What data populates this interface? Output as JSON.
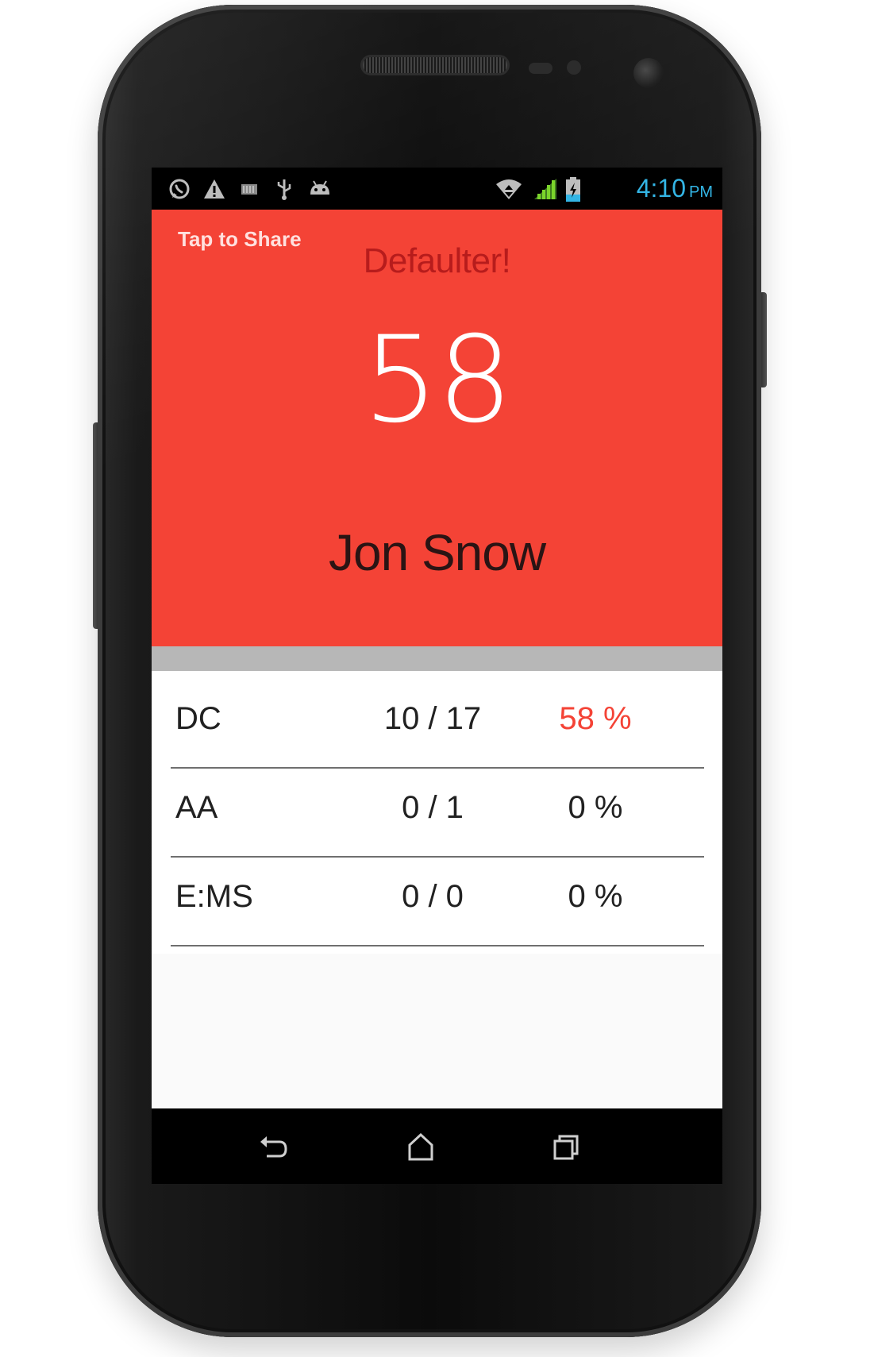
{
  "status_bar": {
    "time": "4:10",
    "ampm": "PM",
    "left_icons": [
      "whatsapp-icon",
      "warning-icon",
      "sdcard-icon",
      "usb-icon",
      "android-debug-icon"
    ],
    "right_icons": [
      "wifi-icon",
      "signal-icon",
      "battery-charging-icon"
    ],
    "time_color": "#33b5e5"
  },
  "hero": {
    "share_label": "Tap to Share",
    "status_title": "Defaulter!",
    "percentage": "58",
    "name": "Jon Snow",
    "background": "#f44336"
  },
  "subjects": [
    {
      "name": "DC",
      "ratio": "10 / 17",
      "percent": "58 %",
      "defaulter": true
    },
    {
      "name": "AA",
      "ratio": "0 / 1",
      "percent": "0 %",
      "defaulter": false
    },
    {
      "name": "E:MS",
      "ratio": "0 / 0",
      "percent": "0 %",
      "defaulter": false
    }
  ],
  "nav": {
    "buttons": [
      "back-icon",
      "home-icon",
      "recents-icon"
    ]
  }
}
